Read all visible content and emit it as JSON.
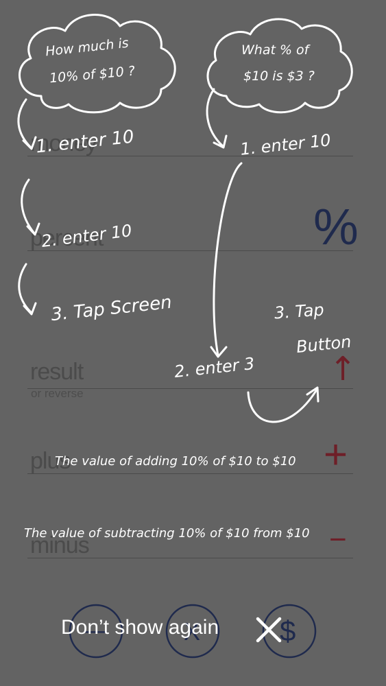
{
  "fields": {
    "money": {
      "label": "money"
    },
    "percent": {
      "label": "percent",
      "symbol": "%"
    },
    "result": {
      "label": "result",
      "sublabel": "or reverse",
      "symbol": "↑"
    },
    "plus": {
      "label": "plus",
      "symbol": "+"
    },
    "minus": {
      "label": "minus",
      "symbol": "−"
    }
  },
  "bottom_buttons": [
    {
      "name": "clear",
      "symbol": "—"
    },
    {
      "name": "multiply",
      "symbol": "X"
    },
    {
      "name": "currency",
      "symbol": "$"
    }
  ],
  "tutorial": {
    "bubble_left": {
      "line1": "How much is",
      "line2": "10% of $10 ?"
    },
    "bubble_right": {
      "line1": "What % of",
      "line2": "$10 is $3 ?"
    },
    "left_step1": "1. enter 10",
    "left_step2": "2. enter 10",
    "left_step3": "3. Tap Screen",
    "right_step1": "1. enter 10",
    "right_step2": "2. enter 3",
    "right_step3_line1": "3. Tap",
    "right_step3_line2": "Button",
    "plus_note": "The value of adding 10% of $10 to $10",
    "minus_note": "The value of subtracting 10% of $10 from $10",
    "dismiss_label": "Don’t show again"
  },
  "colors": {
    "background": "#636363",
    "symbol_navy": "#1f2a4d",
    "symbol_red": "#6e1f28",
    "annotation": "#ffffff"
  }
}
